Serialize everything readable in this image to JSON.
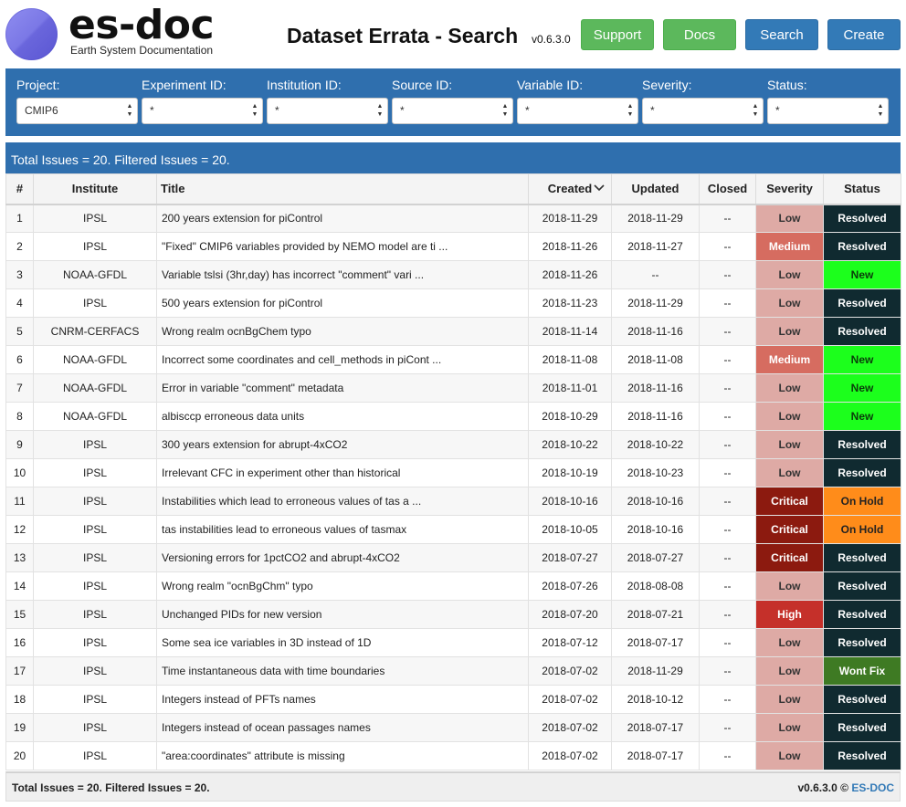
{
  "header": {
    "logo_text": "es-doc",
    "logo_subtitle": "Earth System Documentation",
    "title": "Dataset Errata - Search",
    "version": "v0.6.3.0",
    "buttons": {
      "support": "Support",
      "docs": "Docs",
      "search": "Search",
      "create": "Create"
    }
  },
  "filters": {
    "project": {
      "label": "Project:",
      "value": "CMIP6"
    },
    "experiment": {
      "label": "Experiment ID:",
      "value": "*"
    },
    "institution": {
      "label": "Institution ID:",
      "value": "*"
    },
    "source": {
      "label": "Source ID:",
      "value": "*"
    },
    "variable": {
      "label": "Variable ID:",
      "value": "*"
    },
    "severity": {
      "label": "Severity:",
      "value": "*"
    },
    "status": {
      "label": "Status:",
      "value": "*"
    }
  },
  "results_summary": "Total Issues = 20. Filtered Issues = 20.",
  "table": {
    "headers": [
      "#",
      "Institute",
      "Title",
      "Created",
      "Updated",
      "Closed",
      "Severity",
      "Status"
    ],
    "rows": [
      {
        "num": "1",
        "institute": "IPSL",
        "title": "200 years extension for piControl",
        "created": "2018-11-29",
        "updated": "2018-11-29",
        "closed": "--",
        "severity": "Low",
        "status": "Resolved"
      },
      {
        "num": "2",
        "institute": "IPSL",
        "title": "\"Fixed\" CMIP6 variables provided by NEMO model are ti ...",
        "created": "2018-11-26",
        "updated": "2018-11-27",
        "closed": "--",
        "severity": "Medium",
        "status": "Resolved"
      },
      {
        "num": "3",
        "institute": "NOAA-GFDL",
        "title": "Variable tslsi (3hr,day) has incorrect \"comment\" vari ...",
        "created": "2018-11-26",
        "updated": "--",
        "closed": "--",
        "severity": "Low",
        "status": "New"
      },
      {
        "num": "4",
        "institute": "IPSL",
        "title": "500 years extension for piControl",
        "created": "2018-11-23",
        "updated": "2018-11-29",
        "closed": "--",
        "severity": "Low",
        "status": "Resolved"
      },
      {
        "num": "5",
        "institute": "CNRM-CERFACS",
        "title": "Wrong realm ocnBgChem typo",
        "created": "2018-11-14",
        "updated": "2018-11-16",
        "closed": "--",
        "severity": "Low",
        "status": "Resolved"
      },
      {
        "num": "6",
        "institute": "NOAA-GFDL",
        "title": "Incorrect some coordinates and cell_methods in piCont ...",
        "created": "2018-11-08",
        "updated": "2018-11-08",
        "closed": "--",
        "severity": "Medium",
        "status": "New"
      },
      {
        "num": "7",
        "institute": "NOAA-GFDL",
        "title": "Error in variable \"comment\" metadata",
        "created": "2018-11-01",
        "updated": "2018-11-16",
        "closed": "--",
        "severity": "Low",
        "status": "New"
      },
      {
        "num": "8",
        "institute": "NOAA-GFDL",
        "title": "albisccp erroneous data units",
        "created": "2018-10-29",
        "updated": "2018-11-16",
        "closed": "--",
        "severity": "Low",
        "status": "New"
      },
      {
        "num": "9",
        "institute": "IPSL",
        "title": "300 years extension for abrupt-4xCO2",
        "created": "2018-10-22",
        "updated": "2018-10-22",
        "closed": "--",
        "severity": "Low",
        "status": "Resolved"
      },
      {
        "num": "10",
        "institute": "IPSL",
        "title": "Irrelevant CFC in experiment other than historical",
        "created": "2018-10-19",
        "updated": "2018-10-23",
        "closed": "--",
        "severity": "Low",
        "status": "Resolved"
      },
      {
        "num": "11",
        "institute": "IPSL",
        "title": "Instabilities which lead to erroneous values of tas a ...",
        "created": "2018-10-16",
        "updated": "2018-10-16",
        "closed": "--",
        "severity": "Critical",
        "status": "On Hold"
      },
      {
        "num": "12",
        "institute": "IPSL",
        "title": "tas instabilities lead to erroneous values of tasmax",
        "created": "2018-10-05",
        "updated": "2018-10-16",
        "closed": "--",
        "severity": "Critical",
        "status": "On Hold"
      },
      {
        "num": "13",
        "institute": "IPSL",
        "title": "Versioning errors for 1pctCO2 and abrupt-4xCO2",
        "created": "2018-07-27",
        "updated": "2018-07-27",
        "closed": "--",
        "severity": "Critical",
        "status": "Resolved"
      },
      {
        "num": "14",
        "institute": "IPSL",
        "title": "Wrong realm \"ocnBgChm\" typo",
        "created": "2018-07-26",
        "updated": "2018-08-08",
        "closed": "--",
        "severity": "Low",
        "status": "Resolved"
      },
      {
        "num": "15",
        "institute": "IPSL",
        "title": "Unchanged PIDs for new version",
        "created": "2018-07-20",
        "updated": "2018-07-21",
        "closed": "--",
        "severity": "High",
        "status": "Resolved"
      },
      {
        "num": "16",
        "institute": "IPSL",
        "title": "Some sea ice variables in 3D instead of 1D",
        "created": "2018-07-12",
        "updated": "2018-07-17",
        "closed": "--",
        "severity": "Low",
        "status": "Resolved"
      },
      {
        "num": "17",
        "institute": "IPSL",
        "title": "Time instantaneous data with time boundaries",
        "created": "2018-07-02",
        "updated": "2018-11-29",
        "closed": "--",
        "severity": "Low",
        "status": "Wont Fix"
      },
      {
        "num": "18",
        "institute": "IPSL",
        "title": "Integers instead of PFTs names",
        "created": "2018-07-02",
        "updated": "2018-10-12",
        "closed": "--",
        "severity": "Low",
        "status": "Resolved"
      },
      {
        "num": "19",
        "institute": "IPSL",
        "title": "Integers instead of ocean passages names",
        "created": "2018-07-02",
        "updated": "2018-07-17",
        "closed": "--",
        "severity": "Low",
        "status": "Resolved"
      },
      {
        "num": "20",
        "institute": "IPSL",
        "title": "\"area:coordinates\" attribute is missing",
        "created": "2018-07-02",
        "updated": "2018-07-17",
        "closed": "--",
        "severity": "Low",
        "status": "Resolved"
      }
    ]
  },
  "severity_styles": {
    "Low": {
      "bg": "#deaaa5",
      "fg": "#333333"
    },
    "Medium": {
      "bg": "#d66c60",
      "fg": "#ffffff"
    },
    "High": {
      "bg": "#c5302a",
      "fg": "#ffffff"
    },
    "Critical": {
      "bg": "#8c1a0f",
      "fg": "#ffffff"
    }
  },
  "status_styles": {
    "Resolved": {
      "bg": "#102a30",
      "fg": "#ffffff"
    },
    "New": {
      "bg": "#1cff1c",
      "fg": "#0b3d0b"
    },
    "On Hold": {
      "bg": "#ff8c1a",
      "fg": "#222222"
    },
    "Wont Fix": {
      "bg": "#3e7a23",
      "fg": "#ffffff"
    }
  },
  "footer": {
    "summary": "Total Issues = 20. Filtered Issues = 20.",
    "version": "v0.6.3.0 ©",
    "brand": "ES-DOC"
  },
  "colors": {
    "panel_blue": "#2f6fae",
    "button_green": "#5cb85c",
    "button_blue": "#337ab7"
  }
}
